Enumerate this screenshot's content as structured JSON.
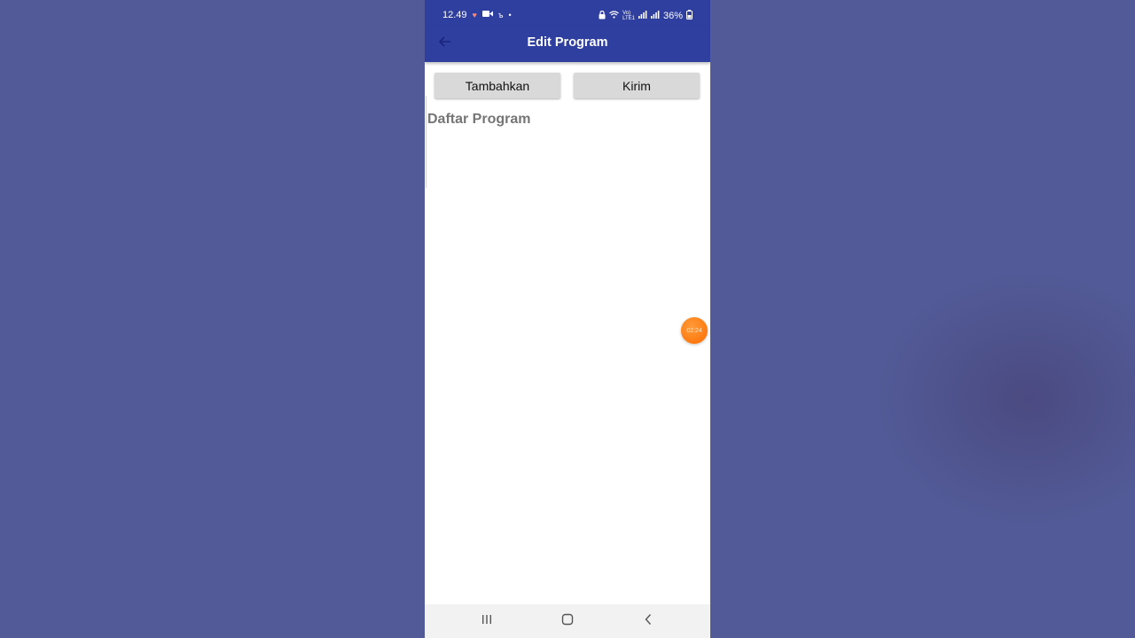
{
  "status_bar": {
    "time": "12.49",
    "battery": "36%",
    "network_label": "Vo)\nLTE1",
    "icons": [
      "heart-icon",
      "video-call-icon",
      "app-b-icon",
      "dot-icon",
      "lock-icon",
      "wifi-icon",
      "signal-icon",
      "signal-icon",
      "battery-icon"
    ]
  },
  "app_bar": {
    "title": "Edit Program",
    "back_icon": "arrow-left-icon",
    "color": "#2f3f9f"
  },
  "actions": {
    "add_label": "Tambahkan",
    "send_label": "Kirim"
  },
  "section": {
    "title": "Daftar Program"
  },
  "overlay": {
    "timer_text": "02:24",
    "color": "#ff7a10"
  },
  "nav_bar": {
    "icons": [
      "recent-apps-icon",
      "home-icon",
      "back-icon"
    ]
  },
  "colors": {
    "background": "#525b98",
    "button": "#d9d9d9",
    "section_text": "#757575"
  }
}
